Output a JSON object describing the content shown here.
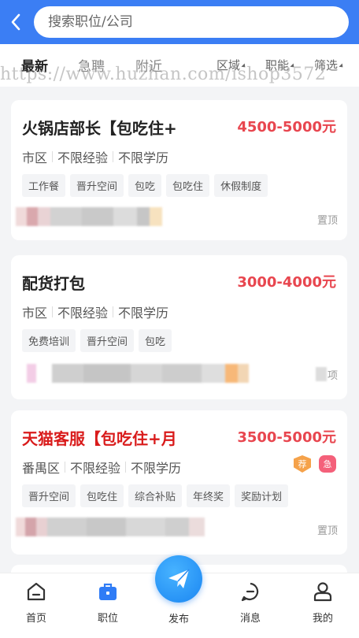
{
  "search": {
    "placeholder": "搜索职位/公司"
  },
  "tabs": [
    {
      "label": "最新"
    },
    {
      "label": "急聘"
    },
    {
      "label": "附近"
    }
  ],
  "filters": [
    {
      "label": "区域"
    },
    {
      "label": "职能"
    },
    {
      "label": "筛选"
    }
  ],
  "watermark": "https://www.huzhan.com/ishop3572",
  "jobs": [
    {
      "title": "火锅店部长【包吃住+",
      "salary": "4500-5000元",
      "district": "市区",
      "experience": "不限经验",
      "education": "不限学历",
      "tags": [
        "工作餐",
        "晋升空间",
        "包吃",
        "包吃住",
        "休假制度"
      ],
      "pin": "置顶"
    },
    {
      "title": "配货打包",
      "salary": "3000-4000元",
      "district": "市区",
      "experience": "不限经验",
      "education": "不限学历",
      "tags": [
        "免费培训",
        "晋升空间",
        "包吃"
      ],
      "pin": "项"
    },
    {
      "title": "天猫客服【包吃住+月",
      "salary": "3500-5000元",
      "district": "番禺区",
      "experience": "不限经验",
      "education": "不限学历",
      "tags": [
        "晋升空间",
        "包吃住",
        "综合补贴",
        "年终奖",
        "奖励计划"
      ],
      "badges": [
        "荐",
        "急"
      ],
      "pin": "置顶"
    }
  ],
  "bottom_nav": {
    "home": "首页",
    "jobs": "职位",
    "publish": "发布",
    "messages": "消息",
    "mine": "我的"
  },
  "colors": {
    "brand": "#3b7ef4",
    "salary": "#e8464f",
    "hot_title": "#d91b1b"
  }
}
